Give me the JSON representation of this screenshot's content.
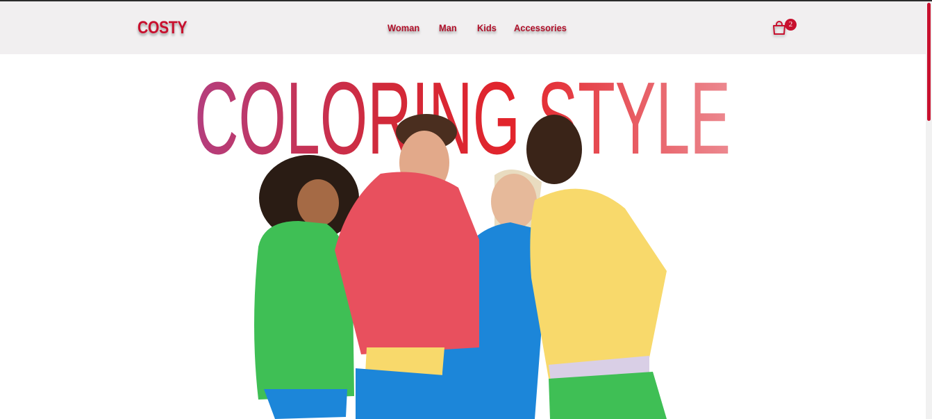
{
  "brand": {
    "logo": "COSTY"
  },
  "nav": {
    "items": [
      {
        "label": "Woman"
      },
      {
        "label": "Man"
      },
      {
        "label": "Kids"
      },
      {
        "label": "Accessories"
      }
    ]
  },
  "cart": {
    "count": "2",
    "icon": "shopping-bag-icon"
  },
  "hero": {
    "headline": "COLORING STYLE",
    "image": "four-models-in-hoodies"
  },
  "colors": {
    "brand_red": "#c8102e",
    "header_bg": "#f1eff0",
    "headline_gradient": [
      "#b43e7e",
      "#d12a3a",
      "#e3242b",
      "#ec8a91"
    ],
    "hoodies": [
      "#3fbf55",
      "#e8505e",
      "#1c86d9",
      "#f8d96b"
    ]
  }
}
